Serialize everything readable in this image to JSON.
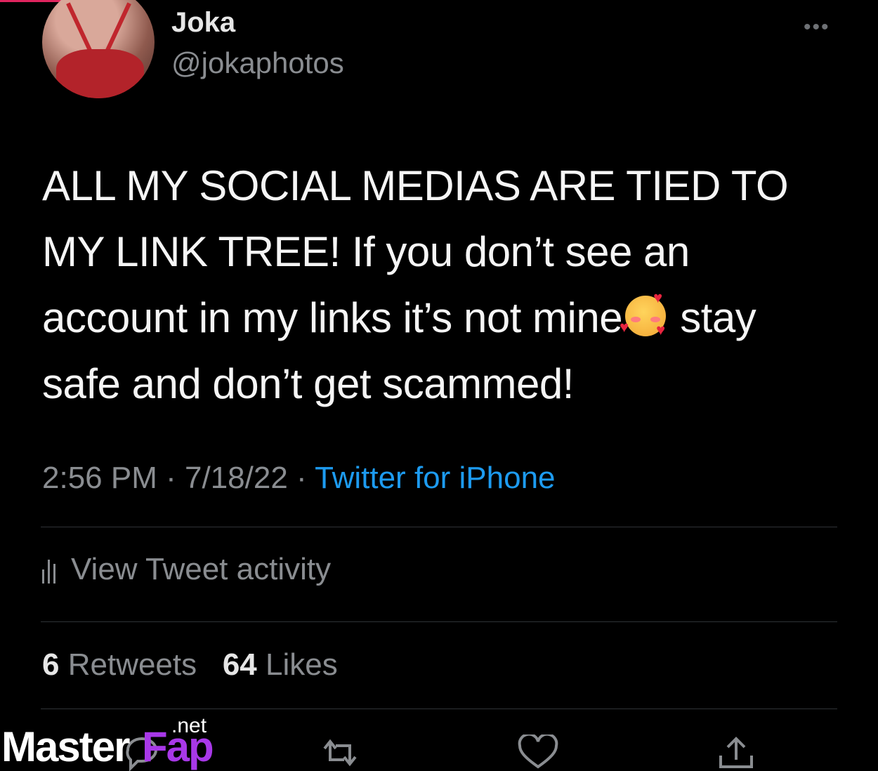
{
  "user": {
    "name": "Joka",
    "handle": "@jokaphotos"
  },
  "tweet": {
    "text_before_emoji": "ALL MY SOCIAL MEDIAS ARE TIED TO MY LINK TREE! If you don’t see an account in my links it’s not mine",
    "emoji": "smiling-face-with-hearts",
    "text_after_emoji": " stay safe and don’t get scammed!",
    "time": "2:56 PM",
    "date": "7/18/22",
    "separator": "·",
    "source": "Twitter for iPhone"
  },
  "activity": {
    "label": "View Tweet activity"
  },
  "stats": {
    "retweets_count": "6",
    "retweets_label": "Retweets",
    "likes_count": "64",
    "likes_label": "Likes"
  },
  "watermark": {
    "brand_a": "Master",
    "brand_b": "Fap",
    "tld": ".net"
  },
  "colors": {
    "background": "#000000",
    "link": "#1d9bf0",
    "muted": "#8a8d91",
    "watermark_accent": "#a838e8"
  }
}
